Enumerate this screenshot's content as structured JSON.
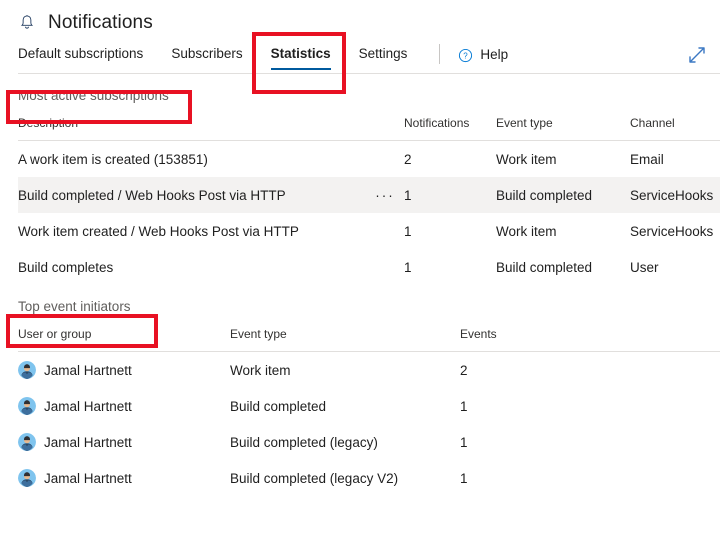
{
  "header": {
    "icon": "bell-icon",
    "title": "Notifications"
  },
  "tabs": [
    {
      "label": "Default subscriptions",
      "selected": false
    },
    {
      "label": "Subscribers",
      "selected": false
    },
    {
      "label": "Statistics",
      "selected": true
    },
    {
      "label": "Settings",
      "selected": false
    }
  ],
  "help": {
    "icon": "question-circle-icon",
    "label": "Help"
  },
  "expand": {
    "icon": "expand-diagonal-icon"
  },
  "sections": {
    "most_active": {
      "title": "Most active subscriptions",
      "columns": [
        "Description",
        "Notifications",
        "Event type",
        "Channel"
      ],
      "rows": [
        {
          "description": "A work item is created (153851)",
          "overflow": "",
          "notifications": "2",
          "event_type": "Work item",
          "channel": "Email",
          "striped": false
        },
        {
          "description": "Build completed / Web Hooks Post via HTTP",
          "overflow": "···",
          "notifications": "1",
          "event_type": "Build completed",
          "channel": "ServiceHooks",
          "striped": true
        },
        {
          "description": "Work item created / Web Hooks Post via HTTP",
          "overflow": "",
          "notifications": "1",
          "event_type": "Work item",
          "channel": "ServiceHooks",
          "striped": false
        },
        {
          "description": "Build completes",
          "overflow": "",
          "notifications": "1",
          "event_type": "Build completed",
          "channel": "User",
          "striped": false
        }
      ]
    },
    "top_initiators": {
      "title": "Top event initiators",
      "columns": [
        "User or group",
        "Event type",
        "Events"
      ],
      "rows": [
        {
          "user": "Jamal Hartnett",
          "avatar": "user-avatar",
          "event_type": "Work item",
          "events": "2"
        },
        {
          "user": "Jamal Hartnett",
          "avatar": "user-avatar",
          "event_type": "Build completed",
          "events": "1"
        },
        {
          "user": "Jamal Hartnett",
          "avatar": "user-avatar",
          "event_type": "Build completed (legacy)",
          "events": "1"
        },
        {
          "user": "Jamal Hartnett",
          "avatar": "user-avatar",
          "event_type": "Build completed (legacy V2)",
          "events": "1"
        }
      ]
    }
  },
  "annotations": [
    {
      "name": "statistics-tab-highlight",
      "color": "#e81123"
    },
    {
      "name": "most-active-subscriptions-highlight",
      "color": "#e81123"
    },
    {
      "name": "top-event-initiators-highlight",
      "color": "#e81123"
    }
  ]
}
